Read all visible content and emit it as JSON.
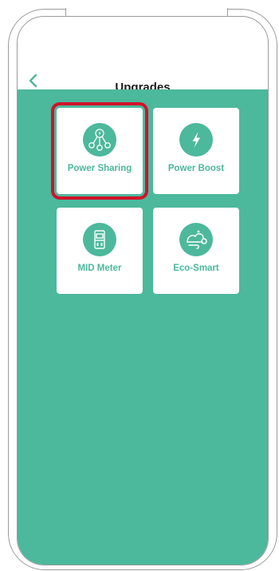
{
  "header": {
    "title": "Upgrades",
    "back_icon": "chevron-left-icon"
  },
  "colors": {
    "accent": "#4cb89c",
    "highlight": "#d2112a",
    "title": "#1c1c1c"
  },
  "tiles": [
    {
      "label": "Power Sharing",
      "icon": "power-sharing-icon",
      "highlighted": true
    },
    {
      "label": "Power Boost",
      "icon": "lightning-bolt-icon",
      "highlighted": false
    },
    {
      "label": "MID Meter",
      "icon": "meter-icon",
      "highlighted": false
    },
    {
      "label": "Eco-Smart",
      "icon": "eco-smart-icon",
      "highlighted": false
    }
  ]
}
